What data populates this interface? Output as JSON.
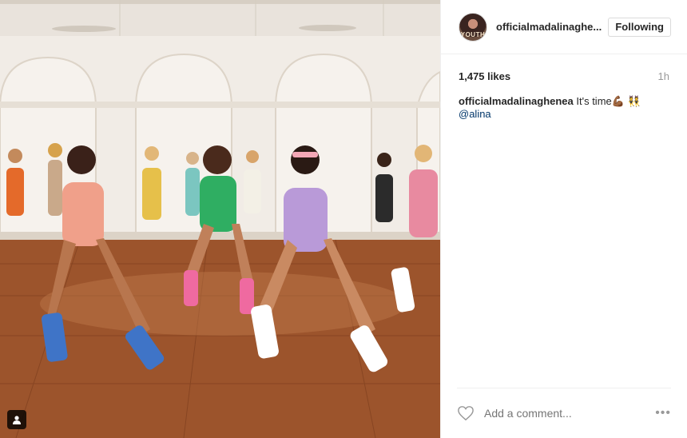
{
  "post": {
    "username": "officialmadalinaghe...",
    "follow_label": "Following",
    "avatar_text": "YOUTH",
    "likes": "1,475 likes",
    "time": "1h",
    "caption_user": "officialmadalinaghenea",
    "caption_text": " It's time",
    "caption_emoji": "💪🏾 👯",
    "caption_mention": "@alina",
    "comment_placeholder": "Add a comment...",
    "more_label": "•••"
  },
  "icons": {
    "user_tag": "user-tag-icon",
    "heart": "heart-icon",
    "more": "more-options-icon"
  }
}
